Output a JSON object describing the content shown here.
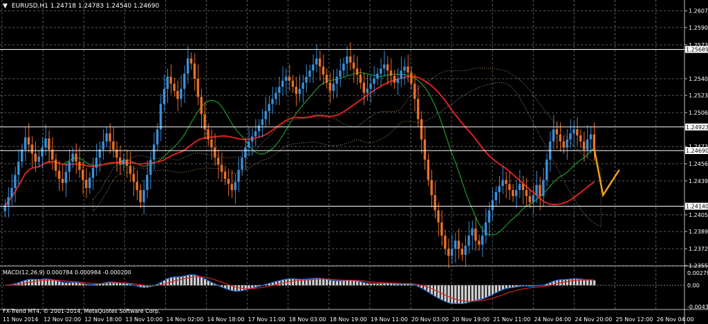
{
  "header": {
    "arrow": "▼",
    "title": "EURUSD,H1  1.24718 1.24783 1.24540 1.24690"
  },
  "macd_label": "MACD(12,26,9) 0.000784 0.000984 -0.000200",
  "footer": "FX-Trend MT4, © 2001-2014, MetaQuotes Software Corp.",
  "colors": {
    "bull": "#3a8fd9",
    "bear": "#e8702a",
    "grid": "#606060",
    "ma_red": "#e02020",
    "ma_green": "#1e9a2a",
    "cloud": "#d8b48a",
    "hline": "#ffffff",
    "forecast": "#f0a020",
    "macd_signal": "#e02020",
    "macd_main": "#2a6fe0",
    "macd_hist": "#d0d0d0"
  },
  "chart_data": {
    "type": "candlestick",
    "symbol": "EURUSD",
    "timeframe": "H1",
    "ylim": [
      1.2355,
      1.2615
    ],
    "y_ticks": [
      "1.26070",
      "1.25905",
      "1.25735",
      "1.25400",
      "1.25235",
      "1.25065",
      "1.24730",
      "1.24560",
      "1.24390",
      "1.24055",
      "1.23890",
      "1.23720",
      "1.23555"
    ],
    "x_ticks": [
      "11 Nov 2014",
      "12 Nov 02:00",
      "12 Nov 18:00",
      "13 Nov 10:00",
      "14 Nov 02:00",
      "14 Nov 18:00",
      "17 Nov 11:00",
      "18 Nov 03:00",
      "18 Nov 19:00",
      "19 Nov 11:00",
      "20 Nov 03:00",
      "20 Nov 19:00",
      "21 Nov 11:00",
      "24 Nov 04:00",
      "24 Nov 20:00",
      "25 Nov 12:00",
      "26 Nov 04:00"
    ],
    "price_lines": [
      {
        "value": 1.25689,
        "label": "1.25689"
      },
      {
        "value": 1.24923,
        "label": "1.24923"
      },
      {
        "value": 1.2469,
        "label": "1.24690"
      },
      {
        "value": 1.2414,
        "label": "1.24140"
      }
    ],
    "closes": [
      1.2415,
      1.2423,
      1.2432,
      1.2445,
      1.2458,
      1.247,
      1.2482,
      1.2475,
      1.2466,
      1.2458,
      1.2463,
      1.2472,
      1.2481,
      1.247,
      1.246,
      1.2449,
      1.2441,
      1.2437,
      1.2448,
      1.2458,
      1.2466,
      1.2458,
      1.245,
      1.244,
      1.2432,
      1.2442,
      1.2452,
      1.2462,
      1.247,
      1.2478,
      1.2486,
      1.2478,
      1.247,
      1.2462,
      1.2455,
      1.246,
      1.2454,
      1.2446,
      1.2438,
      1.243,
      1.2418,
      1.243,
      1.2445,
      1.246,
      1.2475,
      1.249,
      1.2515,
      1.253,
      1.2542,
      1.2535,
      1.2528,
      1.252,
      1.253,
      1.2545,
      1.256,
      1.2555,
      1.254,
      1.2522,
      1.2505,
      1.249,
      1.248,
      1.2472,
      1.2462,
      1.2455,
      1.2448,
      1.2441,
      1.2436,
      1.243,
      1.2438,
      1.245,
      1.2462,
      1.2472,
      1.2478,
      1.2483,
      1.2488,
      1.2494,
      1.25,
      1.2508,
      1.2515,
      1.252,
      1.2526,
      1.2532,
      1.2538,
      1.2542,
      1.2538,
      1.2532,
      1.2525,
      1.253,
      1.2536,
      1.2542,
      1.2548,
      1.2554,
      1.256,
      1.2552,
      1.2544,
      1.2536,
      1.2528,
      1.2535,
      1.2542,
      1.2548,
      1.2555,
      1.2562,
      1.2556,
      1.255,
      1.2544,
      1.2536,
      1.2526,
      1.253,
      1.2535,
      1.254,
      1.2545,
      1.255,
      1.2554,
      1.2548,
      1.2543,
      1.2536,
      1.254,
      1.2548,
      1.2552,
      1.2546,
      1.2535,
      1.252,
      1.25,
      1.248,
      1.246,
      1.244,
      1.2425,
      1.241,
      1.2398,
      1.2385,
      1.2372,
      1.2365,
      1.2372,
      1.238,
      1.2372,
      1.2366,
      1.2375,
      1.2385,
      1.2392,
      1.238,
      1.2376,
      1.2385,
      1.2398,
      1.241,
      1.242,
      1.2428,
      1.2434,
      1.244,
      1.2436,
      1.243,
      1.2424,
      1.243,
      1.2436,
      1.243,
      1.2424,
      1.2418,
      1.2425,
      1.2435,
      1.2424,
      1.244,
      1.246,
      1.2478,
      1.249,
      1.2485,
      1.2478,
      1.2472,
      1.248,
      1.2486,
      1.249,
      1.2484,
      1.2478,
      1.247,
      1.248,
      1.2485,
      1.2469
    ],
    "forecast": [
      [
        0,
        1.247
      ],
      [
        14,
        1.2425
      ],
      [
        40,
        1.245
      ]
    ],
    "macd": {
      "main": 0.000784,
      "signal": 0.000984,
      "hist": -0.0002,
      "y_ticks": [
        "0.002797",
        "0.00",
        "-0.004399"
      ]
    }
  }
}
